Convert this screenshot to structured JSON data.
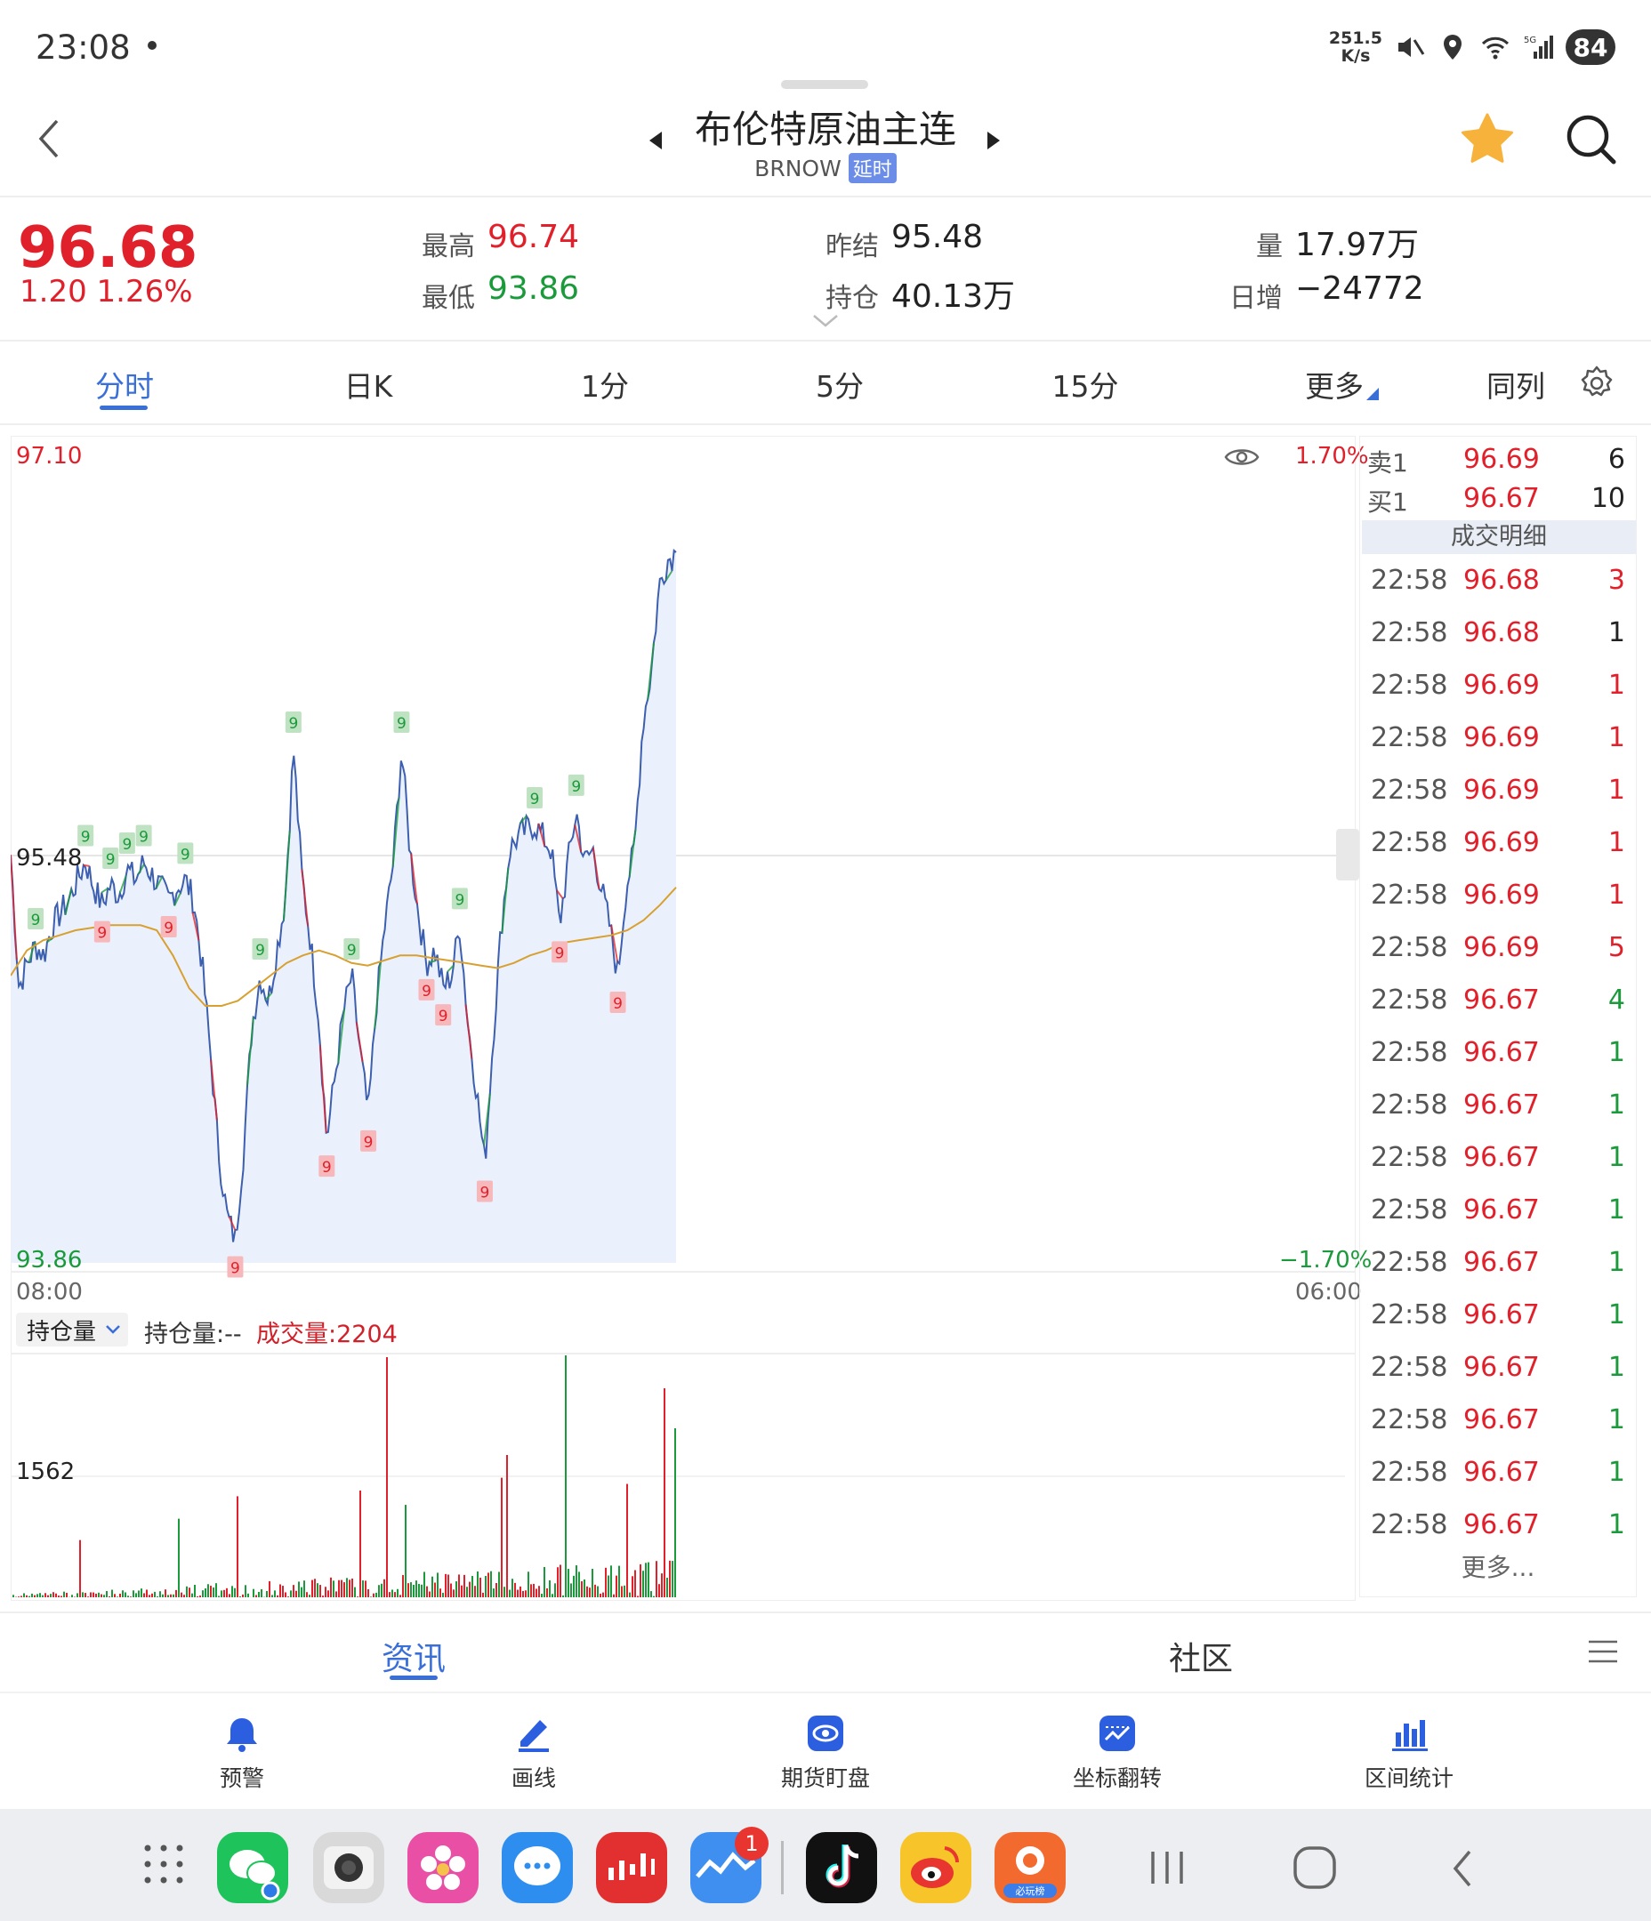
{
  "status_bar": {
    "time": "23:08",
    "net_speed_value": "251.5",
    "net_speed_unit": "K/s",
    "network": "5G",
    "battery": "84"
  },
  "header": {
    "title": "布伦特原油主连",
    "code": "BRNOW",
    "delay_badge": "延时"
  },
  "quote": {
    "price": "96.68",
    "change": "1.20",
    "change_pct": "1.26%",
    "high_label": "最高",
    "high": "96.74",
    "low_label": "最低",
    "low": "93.86",
    "prev_close_label": "昨结",
    "prev_close": "95.48",
    "open_interest_label": "持仓",
    "open_interest": "40.13万",
    "volume_label": "量",
    "volume": "17.97万",
    "daily_increase_label": "日增",
    "daily_increase": "−24772"
  },
  "tabs": [
    "分时",
    "日K",
    "1分",
    "5分",
    "15分",
    "更多",
    "同列"
  ],
  "chart": {
    "price_top": "97.10",
    "price_mid": "95.48",
    "price_bottom": "93.86",
    "pct_top": "1.70%",
    "pct_bottom": "−1.70%",
    "time_start": "08:00",
    "time_end": "06:00",
    "marker_label": "9",
    "indicator_dropdown": "持仓量",
    "oi_text": "持仓量:--",
    "volume_text": "成交量:2204",
    "volume_axis": "1562"
  },
  "chart_data": {
    "type": "line",
    "title": "",
    "ylim": [
      93.86,
      97.1
    ],
    "prev_close": 95.48,
    "x_range": [
      "08:00",
      "06:00"
    ],
    "series": [
      {
        "values": [
          95.48,
          94.95,
          95.05,
          95.12,
          95.08,
          95.2,
          95.25,
          95.3,
          95.38,
          95.45,
          95.35,
          95.28,
          95.36,
          95.32,
          95.42,
          95.38,
          95.45,
          95.4,
          95.35,
          95.3,
          95.35,
          95.38,
          95.3,
          95.05,
          94.7,
          94.3,
          94.05,
          93.95,
          94.3,
          94.8,
          95.0,
          94.9,
          95.1,
          95.3,
          95.9,
          95.4,
          95.15,
          94.85,
          94.35,
          94.6,
          94.85,
          95.0,
          94.7,
          94.45,
          94.9,
          95.2,
          95.45,
          95.9,
          95.5,
          95.25,
          95.05,
          95.1,
          94.95,
          95.0,
          95.2,
          94.8,
          94.55,
          94.25,
          94.75,
          95.2,
          95.5,
          95.55,
          95.58,
          95.6,
          95.55,
          95.5,
          95.2,
          95.45,
          95.65,
          95.45,
          95.5,
          95.35,
          95.2,
          95.0,
          95.35,
          95.5,
          96.0,
          96.2,
          96.55,
          96.65,
          96.68
        ]
      },
      {
        "values": [
          95.0,
          95.1,
          95.14,
          95.16,
          95.18,
          95.19,
          95.2,
          95.2,
          95.2,
          95.18,
          95.08,
          94.95,
          94.88,
          94.88,
          94.9,
          94.95,
          95.0,
          95.05,
          95.08,
          95.1,
          95.08,
          95.05,
          95.04,
          95.06,
          95.08,
          95.08,
          95.07,
          95.06,
          95.05,
          95.04,
          95.03,
          95.05,
          95.08,
          95.1,
          95.13,
          95.14,
          95.15,
          95.16,
          95.18,
          95.22,
          95.28,
          95.35
        ]
      }
    ]
  },
  "order_book": {
    "ask_label": "卖1",
    "ask_price": "96.69",
    "ask_qty": "6",
    "bid_label": "买1",
    "bid_price": "96.67",
    "bid_qty": "10",
    "detail_title": "成交明细",
    "trades": [
      {
        "time": "22:58",
        "price": "96.68",
        "qty": "3",
        "dir": "buy"
      },
      {
        "time": "22:58",
        "price": "96.68",
        "qty": "1",
        "dir": "neutral"
      },
      {
        "time": "22:58",
        "price": "96.69",
        "qty": "1",
        "dir": "buy"
      },
      {
        "time": "22:58",
        "price": "96.69",
        "qty": "1",
        "dir": "buy"
      },
      {
        "time": "22:58",
        "price": "96.69",
        "qty": "1",
        "dir": "buy"
      },
      {
        "time": "22:58",
        "price": "96.69",
        "qty": "1",
        "dir": "buy"
      },
      {
        "time": "22:58",
        "price": "96.69",
        "qty": "1",
        "dir": "buy"
      },
      {
        "time": "22:58",
        "price": "96.69",
        "qty": "5",
        "dir": "buy"
      },
      {
        "time": "22:58",
        "price": "96.67",
        "qty": "4",
        "dir": "sell"
      },
      {
        "time": "22:58",
        "price": "96.67",
        "qty": "1",
        "dir": "sell"
      },
      {
        "time": "22:58",
        "price": "96.67",
        "qty": "1",
        "dir": "sell"
      },
      {
        "time": "22:58",
        "price": "96.67",
        "qty": "1",
        "dir": "sell"
      },
      {
        "time": "22:58",
        "price": "96.67",
        "qty": "1",
        "dir": "sell"
      },
      {
        "time": "22:58",
        "price": "96.67",
        "qty": "1",
        "dir": "sell"
      },
      {
        "time": "22:58",
        "price": "96.67",
        "qty": "1",
        "dir": "sell"
      },
      {
        "time": "22:58",
        "price": "96.67",
        "qty": "1",
        "dir": "sell"
      },
      {
        "time": "22:58",
        "price": "96.67",
        "qty": "1",
        "dir": "sell"
      },
      {
        "time": "22:58",
        "price": "96.67",
        "qty": "1",
        "dir": "sell"
      },
      {
        "time": "22:58",
        "price": "96.67",
        "qty": "1",
        "dir": "sell"
      }
    ],
    "more": "更多..."
  },
  "content_tabs": {
    "news": "资讯",
    "community": "社区"
  },
  "tools": [
    "预警",
    "画线",
    "期货盯盘",
    "坐标翻转",
    "区间统计"
  ],
  "dock": {
    "badge": "1",
    "app_label": "必玩榜"
  },
  "colors": {
    "up": "#e0202a",
    "down": "#1a9a3a",
    "accent": "#3a6fd8",
    "line": "#3c5fb0",
    "avg": "#d8a030"
  }
}
